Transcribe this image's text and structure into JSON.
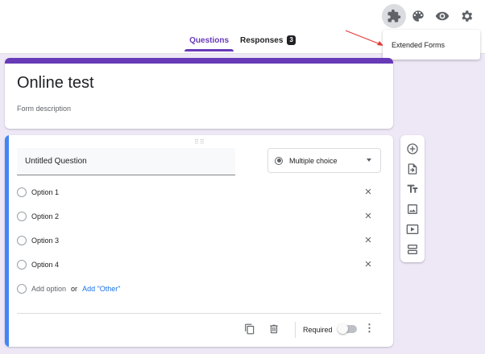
{
  "tabs": [
    {
      "label": "Questions",
      "active": true
    },
    {
      "label": "Responses",
      "badge": "3"
    }
  ],
  "top_icons": [
    "puzzle-icon",
    "palette-icon",
    "eye-icon",
    "gear-icon"
  ],
  "extension_menu": {
    "item": "Extended Forms"
  },
  "form": {
    "title": "Online test",
    "description": "Form description"
  },
  "question": {
    "title": "Untitled Question",
    "type": "Multiple choice",
    "options": [
      "Option 1",
      "Option 2",
      "Option 3",
      "Option 4"
    ],
    "add_option": "Add option",
    "or": "or",
    "add_other": "Add \"Other\"",
    "required_label": "Required",
    "required": false
  },
  "side_toolbar": [
    "add-question-icon",
    "import-questions-icon",
    "add-title-icon",
    "add-image-icon",
    "add-video-icon",
    "add-section-icon"
  ],
  "colors": {
    "accent": "#673ab7",
    "background": "#ede7f6",
    "question_border": "#4285f4",
    "link": "#1a73e8"
  }
}
